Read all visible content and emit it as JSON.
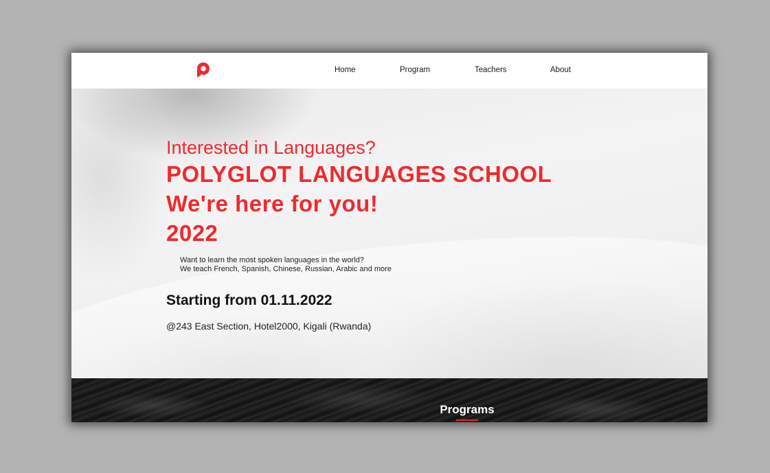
{
  "nav": {
    "logo_icon": "polyglot-p-logo",
    "brand_color": "#ee2a2f",
    "links": [
      "Home",
      "Program",
      "Teachers",
      "About"
    ]
  },
  "hero": {
    "kicker": "Interested in Languages?",
    "title_lines": [
      "POLYGLOT LANGUAGES SCHOOL",
      "We're here for you!",
      "2022"
    ],
    "subtitle_lines": [
      "Want to learn the most spoken languages in the world?",
      "We teach French, Spanish, Chinese, Russian, Arabic and more"
    ],
    "starting": "Starting from 01.11.2022",
    "address": "@243 East Section, Hotel2000, Kigali (Rwanda)"
  },
  "programs": {
    "heading": "Programs",
    "accent_color": "#e32b2b"
  }
}
